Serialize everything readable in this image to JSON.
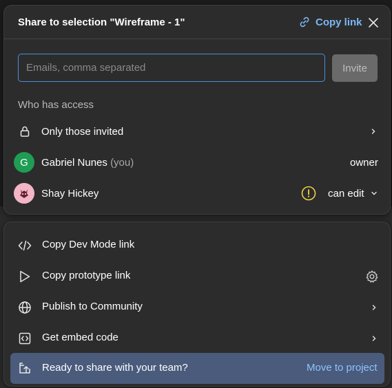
{
  "dialog": {
    "title": "Share to selection \"Wireframe - 1\"",
    "copy_link_label": "Copy link",
    "email_placeholder": "Emails, comma separated",
    "invite_label": "Invite",
    "section_label": "Who has access",
    "access_level": "Only those invited",
    "people": [
      {
        "name": "Gabriel Nunes",
        "suffix": "(you)",
        "avatar_letter": "G",
        "role": "owner"
      },
      {
        "name": "Shay Hickey",
        "role": "can edit"
      }
    ]
  },
  "menu": {
    "items": [
      {
        "label": "Copy Dev Mode link",
        "icon": "code-icon"
      },
      {
        "label": "Copy prototype link",
        "icon": "play-icon"
      },
      {
        "label": "Publish to Community",
        "icon": "globe-icon"
      },
      {
        "label": "Get embed code",
        "icon": "embed-icon"
      }
    ],
    "banner": {
      "label": "Ready to share with your team?",
      "action": "Move to project"
    }
  },
  "colors": {
    "accent": "#7cb7f5",
    "banner": "#4a5b7c",
    "panel": "#2c2c2c",
    "warning": "#f0d24a",
    "avatar_green": "#1f9d55"
  }
}
